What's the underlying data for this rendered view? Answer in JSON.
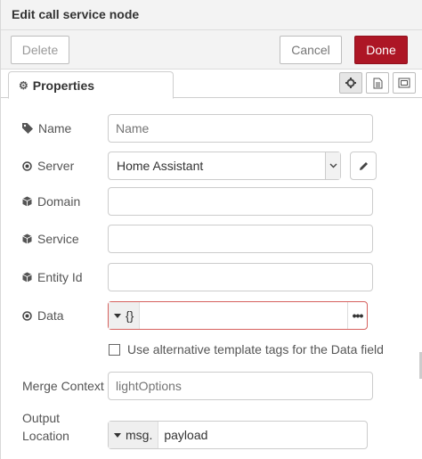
{
  "tray": {
    "title": "Edit call service node"
  },
  "toolbar": {
    "delete_label": "Delete",
    "cancel_label": "Cancel",
    "done_label": "Done",
    "done_color": "#ad1625"
  },
  "tabs": {
    "properties_label": "Properties",
    "icons": [
      "gear-icon",
      "description-icon",
      "appearance-icon"
    ]
  },
  "form": {
    "name": {
      "label": "Name",
      "placeholder": "Name",
      "value": ""
    },
    "server": {
      "label": "Server",
      "value": "Home Assistant"
    },
    "domain": {
      "label": "Domain",
      "value": ""
    },
    "service": {
      "label": "Service",
      "value": ""
    },
    "entity_id": {
      "label": "Entity Id",
      "value": ""
    },
    "data": {
      "label": "Data",
      "type": "{}",
      "value": ""
    },
    "alt_tags": {
      "label": "Use alternative template tags for the Data field",
      "checked": false
    },
    "merge_context": {
      "label": "Merge Context",
      "placeholder": "lightOptions",
      "value": ""
    },
    "output_location": {
      "label_line1": "Output",
      "label_line2": "Location",
      "type": "msg.",
      "value": "payload"
    }
  }
}
